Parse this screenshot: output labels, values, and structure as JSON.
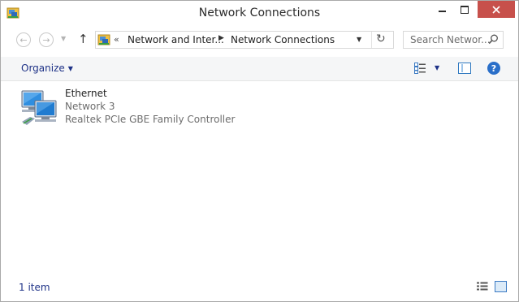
{
  "window": {
    "title": "Network Connections"
  },
  "nav": {
    "breadcrumbs": [
      "Network and Inter...",
      "Network Connections"
    ],
    "overflow_glyph": "«",
    "search_placeholder": "Search Networ..."
  },
  "command_bar": {
    "organize_label": "Organize"
  },
  "items": [
    {
      "name": "Ethernet",
      "status": "Network  3",
      "device": "Realtek PCIe GBE Family Controller",
      "icon": "ethernet-adapter-icon"
    }
  ],
  "status_bar": {
    "item_count": "1 item"
  },
  "colors": {
    "close_button": "#c7504b",
    "link_blue": "#1e3287",
    "selection_blue": "#2f78c0"
  }
}
